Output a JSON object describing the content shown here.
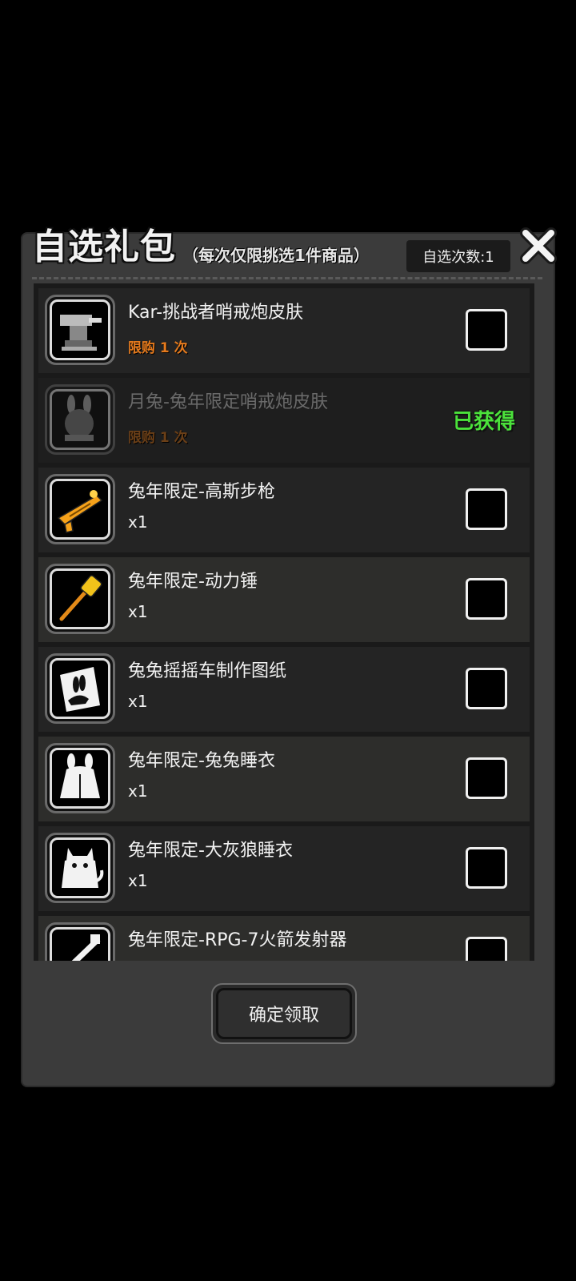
{
  "dialog": {
    "title": "自选礼包",
    "subtitle": "（每次仅限挑选1件商品）",
    "count_label": "自选次数:1",
    "confirm_label": "确定领取"
  },
  "items": [
    {
      "name": "Kar-挑战者哨戒炮皮肤",
      "detail": "限购 1 次",
      "icon": "turret-icon",
      "state": "selectable"
    },
    {
      "name": "月兔-兔年限定哨戒炮皮肤",
      "detail": "限购 1 次",
      "icon": "rabbit-turret-icon",
      "state": "obtained",
      "status": "已获得"
    },
    {
      "name": "兔年限定-高斯步枪",
      "detail": "x1",
      "icon": "gauss-rifle-icon",
      "state": "selectable"
    },
    {
      "name": "兔年限定-动力锤",
      "detail": "x1",
      "icon": "power-hammer-icon",
      "state": "selectable"
    },
    {
      "name": "兔兔摇摇车制作图纸",
      "detail": "x1",
      "icon": "blueprint-icon",
      "state": "selectable"
    },
    {
      "name": "兔年限定-兔兔睡衣",
      "detail": "x1",
      "icon": "rabbit-pajamas-icon",
      "state": "selectable"
    },
    {
      "name": "兔年限定-大灰狼睡衣",
      "detail": "x1",
      "icon": "wolf-pajamas-icon",
      "state": "selectable"
    },
    {
      "name": "兔年限定-RPG-7火箭发射器",
      "detail": "",
      "icon": "rpg-launcher-icon",
      "state": "selectable"
    }
  ],
  "colors": {
    "limit_text": "#e57a1d",
    "obtained_text": "#4be23b",
    "panel_bg": "#3b3b3b"
  }
}
